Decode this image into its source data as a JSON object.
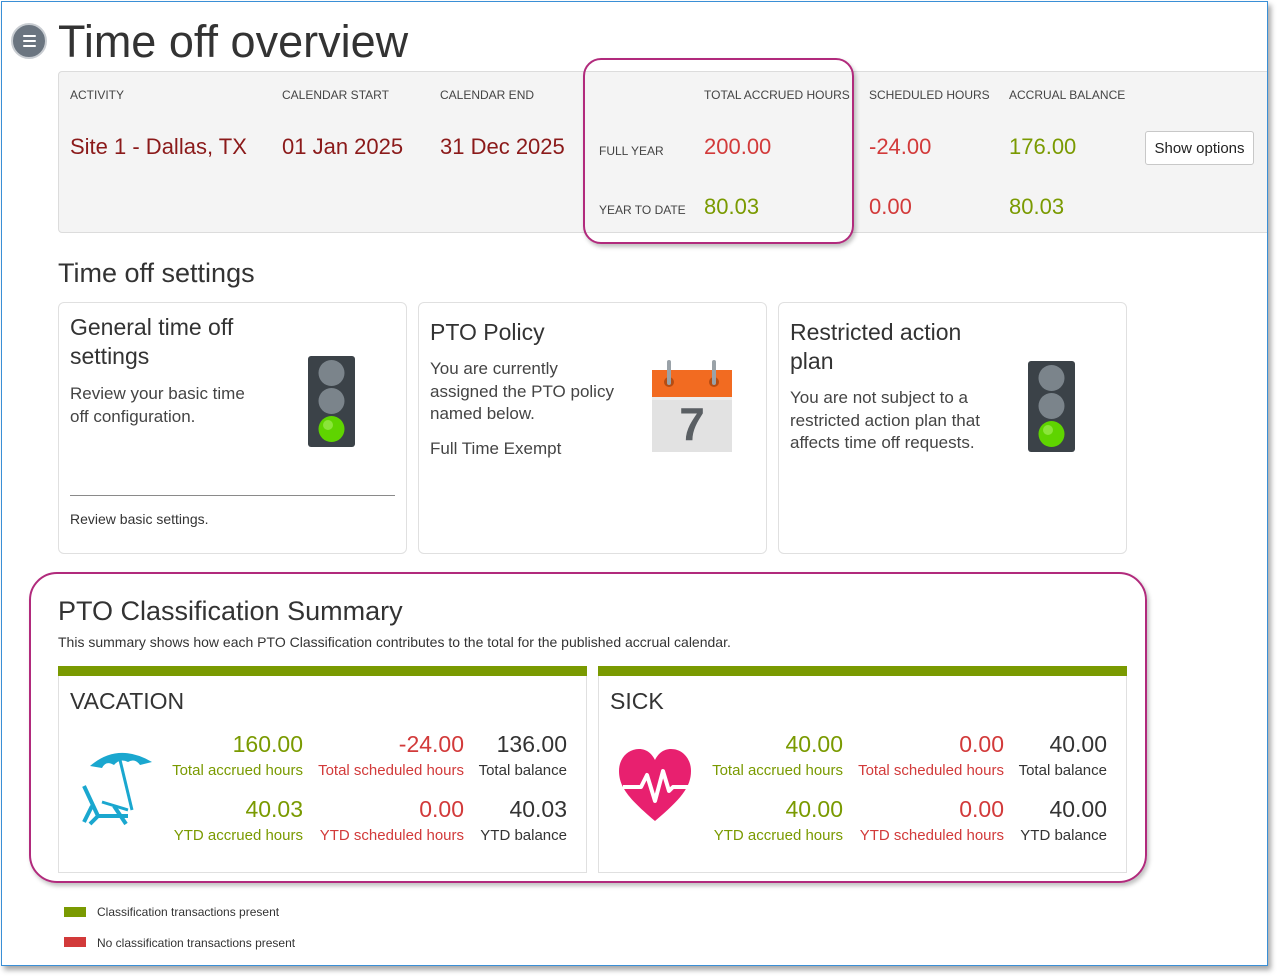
{
  "page": {
    "title": "Time off overview"
  },
  "summary": {
    "headers": {
      "activity": "ACTIVITY",
      "calendar_start": "CALENDAR START",
      "calendar_end": "CALENDAR END",
      "total_accrued": "TOTAL ACCRUED HOURS",
      "scheduled": "SCHEDULED HOURS",
      "balance": "ACCRUAL BALANCE"
    },
    "activity": "Site 1 - Dallas, TX",
    "calendar_start": "01 Jan 2025",
    "calendar_end": "31 Dec 2025",
    "full_year": {
      "label": "FULL YEAR",
      "accrued": "200.00",
      "scheduled": "-24.00",
      "balance": "176.00"
    },
    "year_to_date": {
      "label": "YEAR TO DATE",
      "accrued": "80.03",
      "scheduled": "0.00",
      "balance": "80.03"
    },
    "show_options_label": "Show options"
  },
  "settings": {
    "title": "Time off settings",
    "general": {
      "title_l1": "General time off",
      "title_l2": "settings",
      "desc_l1": "Review your basic time",
      "desc_l2": "off configuration.",
      "link": "Review basic settings.",
      "icon": "traffic-light-green-icon"
    },
    "pto_policy": {
      "title": "PTO Policy",
      "desc_l1": "You are currently",
      "desc_l2": "assigned the PTO policy",
      "desc_l3": "named below.",
      "policy_name": "Full Time Exempt",
      "calendar_day": "7",
      "icon": "calendar-icon"
    },
    "restricted": {
      "title_l1": "Restricted action",
      "title_l2": "plan",
      "desc_l1": "You are not subject to a",
      "desc_l2": "restricted action plan that",
      "desc_l3": "affects time off requests.",
      "icon": "traffic-light-green-icon"
    }
  },
  "pto_summary": {
    "title": "PTO Classification Summary",
    "subtitle": "This summary shows how each PTO Classification contributes to the total for the published accrual calendar.",
    "vacation": {
      "title": "VACATION",
      "icon": "beach-chair-umbrella-icon",
      "total_accrued": "160.00",
      "total_accrued_label": "Total accrued hours",
      "total_scheduled": "-24.00",
      "total_scheduled_label": "Total scheduled hours",
      "total_balance": "136.00",
      "total_balance_label": "Total balance",
      "ytd_accrued": "40.03",
      "ytd_accrued_label": "YTD accrued hours",
      "ytd_scheduled": "0.00",
      "ytd_scheduled_label": "YTD scheduled hours",
      "ytd_balance": "40.03",
      "ytd_balance_label": "YTD balance"
    },
    "sick": {
      "title": "SICK",
      "icon": "heart-pulse-icon",
      "total_accrued": "40.00",
      "total_accrued_label": "Total accrued hours",
      "total_scheduled": "0.00",
      "total_scheduled_label": "Total scheduled hours",
      "total_balance": "40.00",
      "total_balance_label": "Total balance",
      "ytd_accrued": "40.00",
      "ytd_accrued_label": "YTD accrued hours",
      "ytd_scheduled": "0.00",
      "ytd_scheduled_label": "YTD scheduled hours",
      "ytd_balance": "40.00",
      "ytd_balance_label": "YTD balance"
    }
  },
  "legend": {
    "present": "Classification transactions present",
    "absent": "No classification transactions present"
  },
  "colors": {
    "green": "#7a9a01",
    "red": "#d23a3a",
    "dark_red": "#8b1a1a",
    "highlight": "#b12a7c"
  }
}
